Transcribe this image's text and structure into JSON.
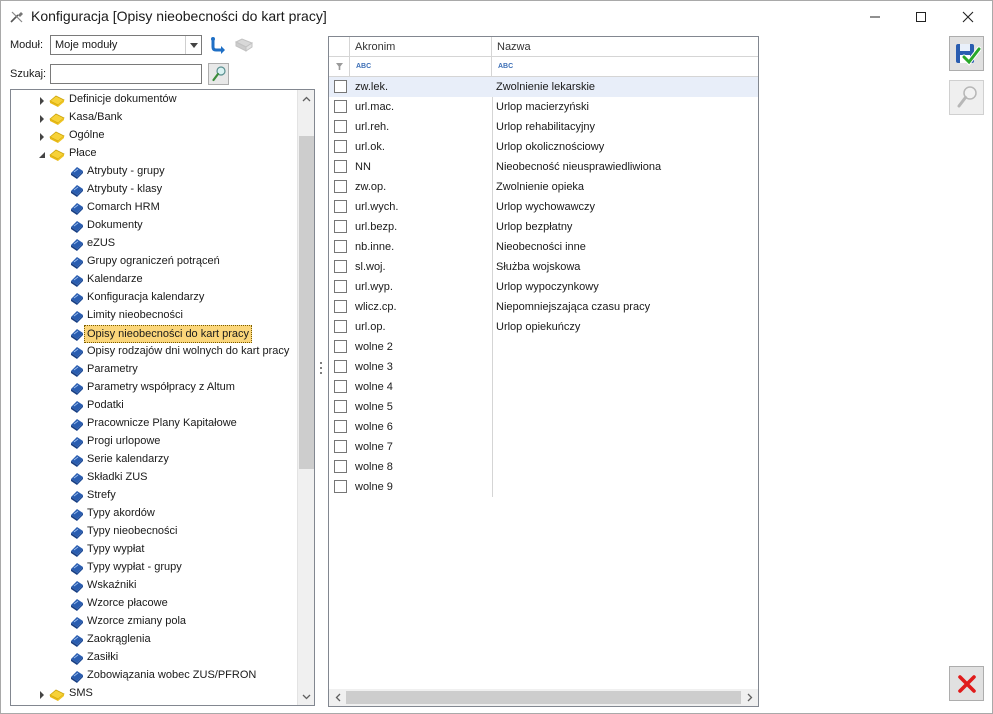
{
  "window": {
    "title": "Konfiguracja [Opisy nieobecności do kart pracy]"
  },
  "toolbar": {
    "module_label": "Moduł:",
    "module_value": "Moje moduły",
    "search_label": "Szukaj:",
    "search_value": ""
  },
  "tree": {
    "items": [
      {
        "label": "Definicje dokumentów",
        "level": 0,
        "expanded": false
      },
      {
        "label": "Kasa/Bank",
        "level": 0,
        "expanded": false
      },
      {
        "label": "Ogólne",
        "level": 0,
        "expanded": false
      },
      {
        "label": "Płace",
        "level": 0,
        "expanded": true
      },
      {
        "label": "Atrybuty - grupy",
        "level": 1
      },
      {
        "label": "Atrybuty - klasy",
        "level": 1
      },
      {
        "label": "Comarch HRM",
        "level": 1
      },
      {
        "label": "Dokumenty",
        "level": 1
      },
      {
        "label": "eZUS",
        "level": 1
      },
      {
        "label": "Grupy ograniczeń potrąceń",
        "level": 1
      },
      {
        "label": "Kalendarze",
        "level": 1
      },
      {
        "label": "Konfiguracja kalendarzy",
        "level": 1
      },
      {
        "label": "Limity nieobecności",
        "level": 1
      },
      {
        "label": "Opisy nieobecności do kart pracy",
        "level": 1,
        "selected": true
      },
      {
        "label": "Opisy rodzajów dni wolnych do kart pracy",
        "level": 1
      },
      {
        "label": "Parametry",
        "level": 1
      },
      {
        "label": "Parametry współpracy z Altum",
        "level": 1
      },
      {
        "label": "Podatki",
        "level": 1
      },
      {
        "label": "Pracownicze Plany Kapitałowe",
        "level": 1
      },
      {
        "label": "Progi urlopowe",
        "level": 1
      },
      {
        "label": "Serie kalendarzy",
        "level": 1
      },
      {
        "label": "Składki ZUS",
        "level": 1
      },
      {
        "label": "Strefy",
        "level": 1
      },
      {
        "label": "Typy akordów",
        "level": 1
      },
      {
        "label": "Typy nieobecności",
        "level": 1
      },
      {
        "label": "Typy wypłat",
        "level": 1
      },
      {
        "label": "Typy wypłat - grupy",
        "level": 1
      },
      {
        "label": "Wskaźniki",
        "level": 1
      },
      {
        "label": "Wzorce płacowe",
        "level": 1
      },
      {
        "label": "Wzorce zmiany pola",
        "level": 1
      },
      {
        "label": "Zaokrąglenia",
        "level": 1
      },
      {
        "label": "Zasiłki",
        "level": 1
      },
      {
        "label": "Zobowiązania wobec ZUS/PFRON",
        "level": 1
      },
      {
        "label": "SMS",
        "level": 0,
        "expanded": false
      }
    ]
  },
  "grid": {
    "columns": [
      "Akronim",
      "Nazwa"
    ],
    "filter_icon_text": "ABC",
    "rows": [
      {
        "akronim": "zw.lek.",
        "nazwa": "Zwolnienie lekarskie",
        "current": true
      },
      {
        "akronim": "url.mac.",
        "nazwa": "Urlop macierzyński"
      },
      {
        "akronim": "url.reh.",
        "nazwa": "Urlop rehabilitacyjny"
      },
      {
        "akronim": "url.ok.",
        "nazwa": "Urlop okolicznościowy"
      },
      {
        "akronim": "NN",
        "nazwa": "Nieobecność nieusprawiedliwiona"
      },
      {
        "akronim": "zw.op.",
        "nazwa": "Zwolnienie opieka"
      },
      {
        "akronim": "url.wych.",
        "nazwa": "Urlop wychowawczy"
      },
      {
        "akronim": "url.bezp.",
        "nazwa": "Urlop bezpłatny"
      },
      {
        "akronim": "nb.inne.",
        "nazwa": "Nieobecności inne"
      },
      {
        "akronim": "sl.woj.",
        "nazwa": "Służba wojskowa"
      },
      {
        "akronim": "url.wyp.",
        "nazwa": "Urlop wypoczynkowy"
      },
      {
        "akronim": "wlicz.cp.",
        "nazwa": "Niepomniejszająca czasu pracy"
      },
      {
        "akronim": "url.op.",
        "nazwa": "Urlop opiekuńczy"
      },
      {
        "akronim": "wolne 2",
        "nazwa": ""
      },
      {
        "akronim": "wolne 3",
        "nazwa": ""
      },
      {
        "akronim": "wolne 4",
        "nazwa": ""
      },
      {
        "akronim": "wolne 5",
        "nazwa": ""
      },
      {
        "akronim": "wolne 6",
        "nazwa": ""
      },
      {
        "akronim": "wolne 7",
        "nazwa": ""
      },
      {
        "akronim": "wolne 8",
        "nazwa": ""
      },
      {
        "akronim": "wolne 9",
        "nazwa": ""
      }
    ]
  },
  "colors": {
    "selection": "#fbd67a",
    "current_row": "#e8eef9",
    "accent_blue": "#1f6fc5",
    "close_red": "#e01b1b"
  },
  "icons": {
    "app": "configuration-tools-icon",
    "folder": "folder-icon",
    "leaf": "blue-item-icon",
    "save": "save-check-icon",
    "search": "magnifier-icon",
    "cancel": "red-x-icon"
  }
}
